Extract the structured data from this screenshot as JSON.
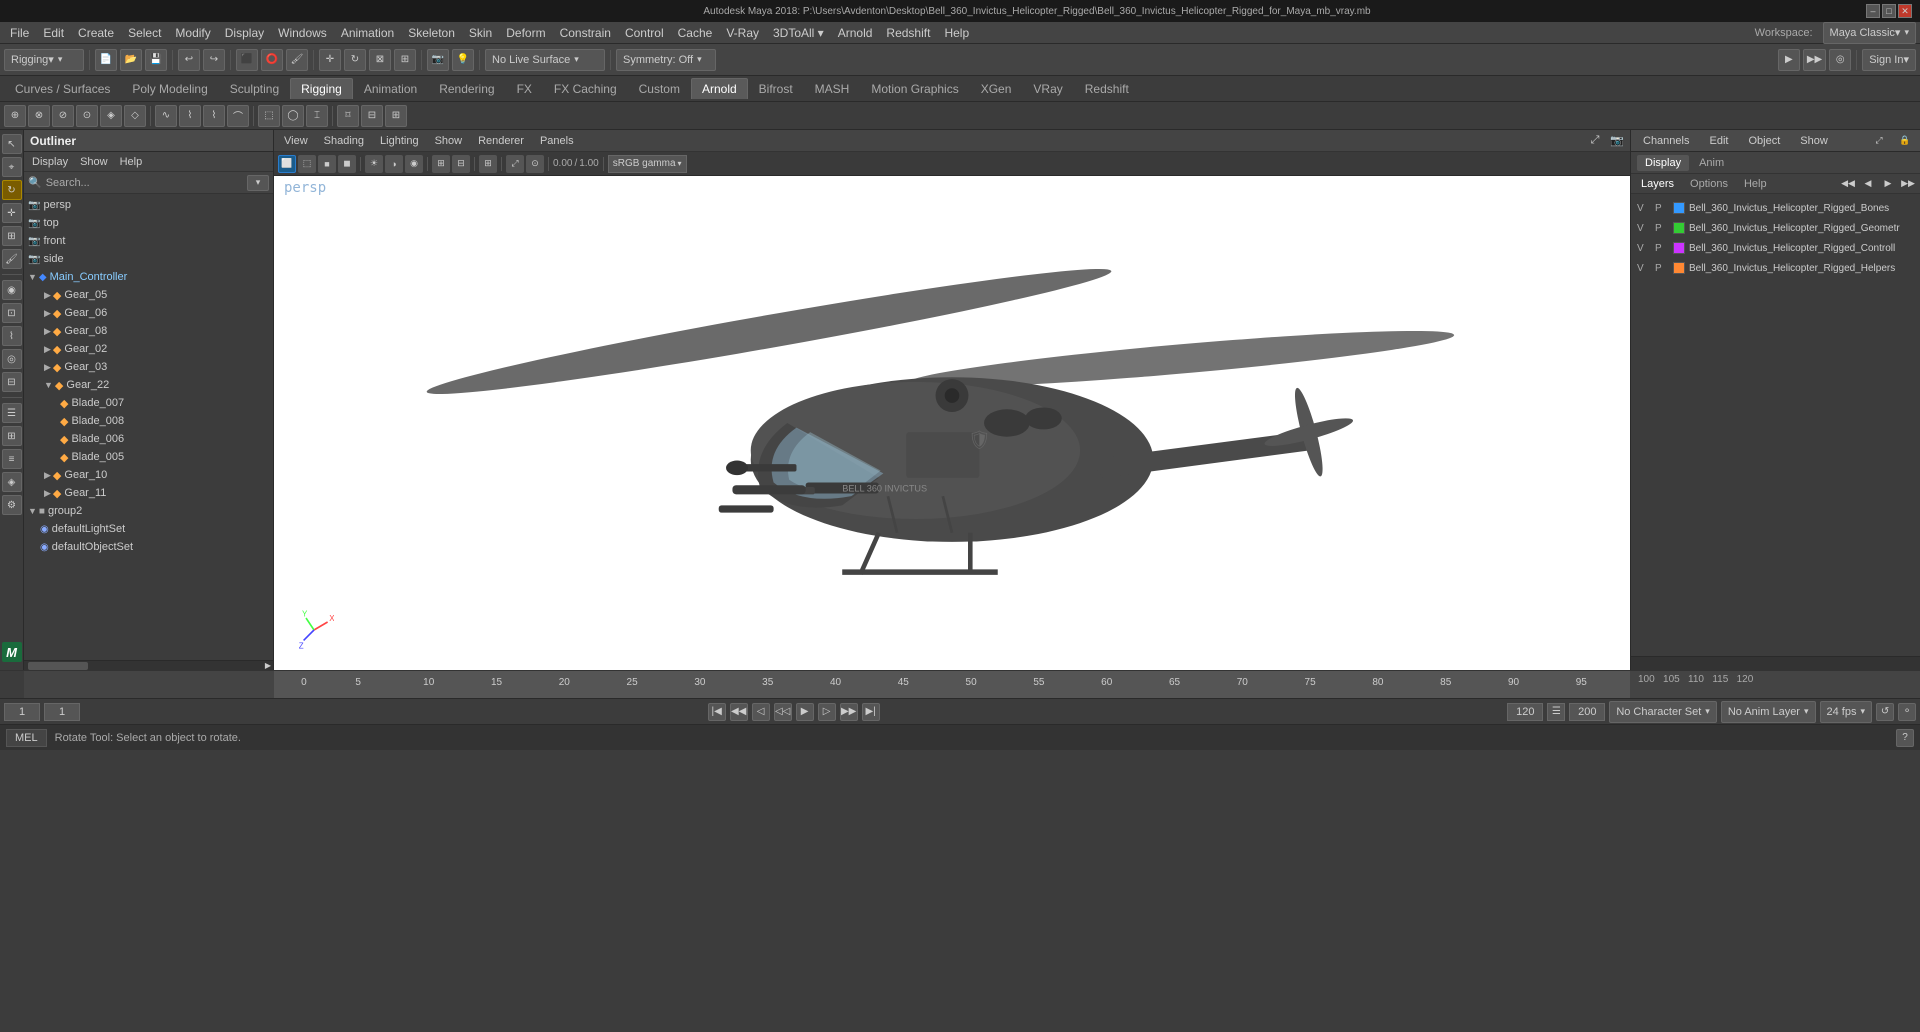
{
  "titleBar": {
    "title": "Autodesk Maya 2018: P:\\Users\\Avdenton\\Desktop\\Bell_360_Invictus_Helicopter_Rigged\\Bell_360_Invictus_Helicopter_Rigged_for_Maya_mb_vray.mb",
    "minimizeLabel": "–",
    "maximizeLabel": "□",
    "closeLabel": "✕"
  },
  "menuBar": {
    "items": [
      "File",
      "Edit",
      "Create",
      "Select",
      "Modify",
      "Display",
      "Windows",
      "Animation",
      "Skeleton",
      "Skin",
      "Deform",
      "Constrain",
      "Control",
      "Cache",
      "V-Ray",
      "3DtoAll ▾",
      "Arnold",
      "Redshift",
      "Help"
    ]
  },
  "toolbar": {
    "workspace": "Workspace:",
    "workspaceName": "Maya Classic▾",
    "riggingLabel": "Rigging▾",
    "noLiveSurface": "No Live Surface",
    "symmetryOff": "Symmetry: Off",
    "signIn": "Sign In▾"
  },
  "moduleTabs": {
    "items": [
      "Curves / Surfaces",
      "Poly Modeling",
      "Sculpting",
      "Rigging",
      "Animation",
      "Rendering",
      "FX",
      "FX Caching",
      "Custom",
      "Arnold",
      "Bifrost",
      "MASH",
      "Motion Graphics",
      "XGen",
      "VRay",
      "Redshift"
    ]
  },
  "outliner": {
    "title": "Outliner",
    "menuItems": [
      "Display",
      "Show",
      "Help"
    ],
    "searchPlaceholder": "Search...",
    "items": [
      {
        "name": "persp",
        "type": "camera",
        "indent": 0
      },
      {
        "name": "top",
        "type": "camera",
        "indent": 0
      },
      {
        "name": "front",
        "type": "camera",
        "indent": 0
      },
      {
        "name": "side",
        "type": "camera",
        "indent": 0
      },
      {
        "name": "Main_Controller",
        "type": "controller",
        "indent": 0,
        "expanded": true
      },
      {
        "name": "Gear_05",
        "type": "gear",
        "indent": 1
      },
      {
        "name": "Gear_06",
        "type": "gear",
        "indent": 1
      },
      {
        "name": "Gear_08",
        "type": "gear",
        "indent": 1
      },
      {
        "name": "Gear_02",
        "type": "gear",
        "indent": 1
      },
      {
        "name": "Gear_03",
        "type": "gear",
        "indent": 1
      },
      {
        "name": "Gear_22",
        "type": "gear",
        "indent": 1,
        "expanded": true
      },
      {
        "name": "Blade_007",
        "type": "gear",
        "indent": 2
      },
      {
        "name": "Blade_008",
        "type": "gear",
        "indent": 2
      },
      {
        "name": "Blade_006",
        "type": "gear",
        "indent": 2
      },
      {
        "name": "Blade_005",
        "type": "gear",
        "indent": 2
      },
      {
        "name": "Gear_10",
        "type": "gear",
        "indent": 1
      },
      {
        "name": "Gear_11",
        "type": "gear",
        "indent": 1
      },
      {
        "name": "group2",
        "type": "group",
        "indent": 0,
        "expanded": true
      },
      {
        "name": "defaultLightSet",
        "type": "set",
        "indent": 1
      },
      {
        "name": "defaultObjectSet",
        "type": "set",
        "indent": 1
      }
    ]
  },
  "viewport": {
    "menuItems": [
      "View",
      "Shading",
      "Lighting",
      "Show",
      "Renderer",
      "Panels"
    ],
    "viewLabel": "persp",
    "gammaLabel": "sRGB gamma",
    "axisLabel": "XYZ"
  },
  "channelsPanel": {
    "menuItems": [
      "Channels",
      "Edit",
      "Object",
      "Show"
    ],
    "displayTab": "Display",
    "animTab": "Anim",
    "layersLabel": "Layers",
    "optionsLabel": "Options",
    "helpLabel": "Help",
    "scrollButtons": [
      "◀",
      "◀",
      "▶",
      "▶"
    ],
    "layers": [
      {
        "v": "V",
        "p": "P",
        "color": "#3399ff",
        "name": "Bell_360_Invictus_Helicopter_Rigged_Bones"
      },
      {
        "v": "V",
        "p": "P",
        "color": "#33ff33",
        "name": "Bell_360_Invictus_Helicopter_Rigged_Geometr"
      },
      {
        "v": "V",
        "p": "P",
        "color": "#cc33ff",
        "name": "Bell_360_Invictus_Helicopter_Rigged_Controll"
      },
      {
        "v": "V",
        "p": "P",
        "color": "#ff8833",
        "name": "Bell_360_Invictus_Helicopter_Rigged_Helpers"
      }
    ]
  },
  "timeline": {
    "ticks": [
      0,
      5,
      10,
      15,
      20,
      25,
      30,
      35,
      40,
      45,
      50,
      55,
      60,
      65,
      70,
      75,
      80,
      85,
      90,
      95,
      100,
      105,
      110,
      115,
      120
    ],
    "startFrame": "1",
    "endFrame": "120",
    "currentFrame": "1",
    "rangeStart": "1",
    "rangeEnd": "200",
    "fps": "24 fps",
    "noCharacterSet": "No Character Set",
    "noAnimLayer": "No Anim Layer"
  },
  "statusBar": {
    "scriptType": "MEL",
    "message": "Rotate Tool: Select an object to rotate."
  },
  "playback": {
    "prevKey": "◀◀",
    "prev": "◀",
    "stepBack": "◁",
    "play": "▶",
    "stepFwd": "▷",
    "next": "▶",
    "nextKey": "▶▶",
    "loopIcon": "↺"
  }
}
